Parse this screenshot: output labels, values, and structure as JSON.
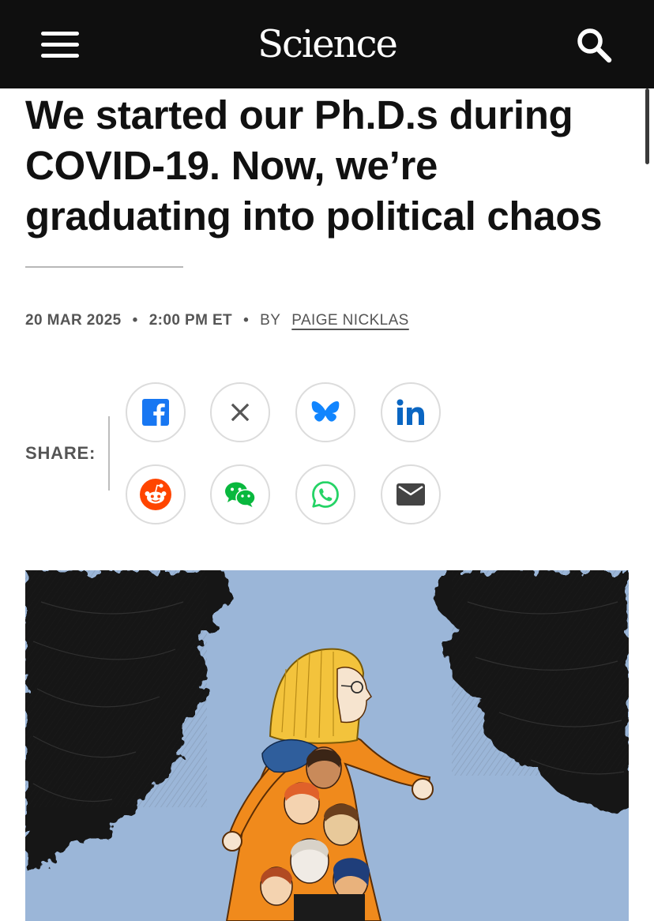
{
  "header": {
    "logo_text": "Science",
    "menu_icon": "hamburger-menu-icon",
    "search_icon": "search-icon",
    "background_color": "#0f0f0f"
  },
  "article": {
    "headline": "We started our Ph.D.s during COVID-19. Now, we’re graduating into political chaos",
    "date": "20 MAR 2025",
    "time": "2:00 PM ET",
    "by_label": "BY",
    "author": "PAIGE NICKLAS"
  },
  "share": {
    "label": "SHARE:",
    "buttons": [
      {
        "name": "facebook",
        "icon": "facebook-icon",
        "color": "#1877f2"
      },
      {
        "name": "x",
        "icon": "x-icon",
        "color": "#555555"
      },
      {
        "name": "bluesky",
        "icon": "bluesky-icon",
        "color": "#1185fe"
      },
      {
        "name": "linkedin",
        "icon": "linkedin-icon",
        "color": "#0a66c2"
      },
      {
        "name": "reddit",
        "icon": "reddit-icon",
        "color": "#ff4500"
      },
      {
        "name": "wechat",
        "icon": "wechat-icon",
        "color": "#09b83e"
      },
      {
        "name": "whatsapp",
        "icon": "whatsapp-icon",
        "color": "#25d366"
      },
      {
        "name": "email",
        "icon": "email-icon",
        "color": "#444444"
      }
    ]
  },
  "hero_image": {
    "description_icon": "illustration-graduates-walking-under-storm-clouds",
    "sky_color": "#9bb6d8",
    "cloud_color": "#141414"
  }
}
